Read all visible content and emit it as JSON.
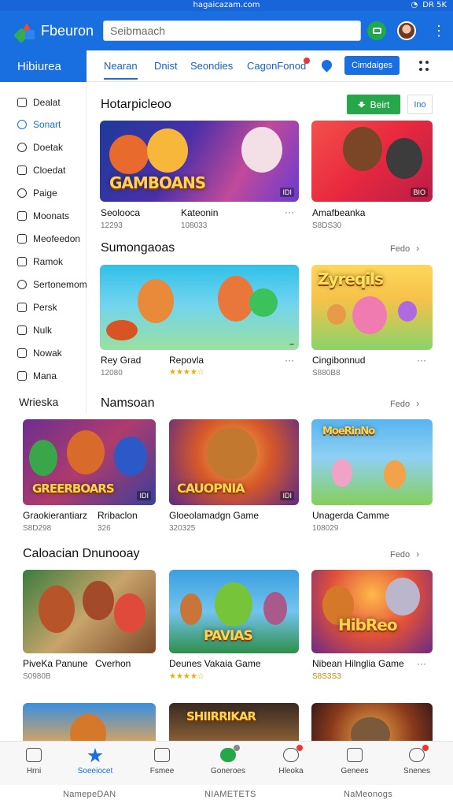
{
  "status": {
    "url": "hagaicazam.com",
    "right": "DR 5K"
  },
  "app": {
    "name": "Fbeuron",
    "search_placeholder": "Seibmaach"
  },
  "tabs": {
    "section_title": "Hibiurea",
    "items": [
      "Nearan",
      "Dnist",
      "Seondies",
      "CagonFonod"
    ],
    "promo": "Cimdaiges"
  },
  "sidebar": {
    "items": [
      "Dealat",
      "Sonart",
      "Doetak",
      "Cloedat",
      "Paige",
      "Moonats",
      "Meofeedon",
      "Ramok",
      "Sertonemom",
      "Persk",
      "Nulk",
      "Nowak",
      "Mana"
    ],
    "heading": "Wrieska"
  },
  "sections": [
    {
      "title": "Hotarpicleoo",
      "actions": {
        "primary": "Beirt",
        "secondary": "Ino"
      },
      "cards": [
        {
          "caption": "GAMBOANS",
          "corner": "IDI",
          "title": "Seolooca",
          "sub": "12293",
          "extra_title": "Kateonin",
          "extra_sub": "108033"
        },
        {
          "caption": "",
          "corner": "BIO",
          "title": "Amafbeanka",
          "sub": "S8DS30",
          "extra_title": "",
          "extra_sub": ""
        }
      ]
    },
    {
      "title": "Sumongaoas",
      "see_all": "Fedo",
      "cards": [
        {
          "caption": "",
          "corner": "",
          "title": "Rey Grad",
          "sub": "12080",
          "extra_title": "Repovla",
          "stars": "★★★★☆"
        },
        {
          "caption": "Zyreqils",
          "corner": "",
          "title": "Cingibonnud",
          "sub": "S880B8"
        }
      ]
    },
    {
      "title": "Namsoan",
      "see_all": "Fedo",
      "cards": [
        {
          "caption": "GREERBOARS",
          "corner": "IDI",
          "title": "Graokierantiarz",
          "sub": "S8D298",
          "extra_title": "Rribaclon",
          "extra_sub": "326"
        },
        {
          "caption": "CAUOPNIA",
          "corner": "IDI",
          "title": "Gloeolamadgn Game",
          "sub": "320325"
        },
        {
          "caption": "MoeRinNo",
          "corner": "",
          "title": "Unagerda Camme",
          "sub": "108029"
        }
      ]
    },
    {
      "title": "Caloacian Dnunooay",
      "see_all": "Fedo",
      "cards": [
        {
          "caption": "",
          "corner": "",
          "title": "PiveKa Panune",
          "sub": "S0980B",
          "extra_title": "Cverhon"
        },
        {
          "caption": "PAVIAS",
          "corner": "",
          "title": "Deunes Vakaia Game",
          "stars": "★★★★☆"
        },
        {
          "caption": "HibReo",
          "corner": "",
          "title": "Nibean Hilnglia Game",
          "sub": "S8S3S3"
        }
      ]
    },
    {
      "title": "",
      "cards": [
        {
          "caption": ""
        },
        {
          "caption": "SHIIRRIKAR"
        },
        {
          "caption": ""
        }
      ]
    }
  ],
  "bottom_nav": [
    "Hrni",
    "Soeeiocet",
    "Fsmee",
    "Goneroes",
    "Hleoka",
    "Genees",
    "Snenes"
  ],
  "footer": [
    "NamepeDAN",
    "NIAMETETS",
    "NaMeonogs"
  ],
  "colors": {
    "primary": "#1a6fe0",
    "green": "#26a84a",
    "badge": "#e53935"
  }
}
